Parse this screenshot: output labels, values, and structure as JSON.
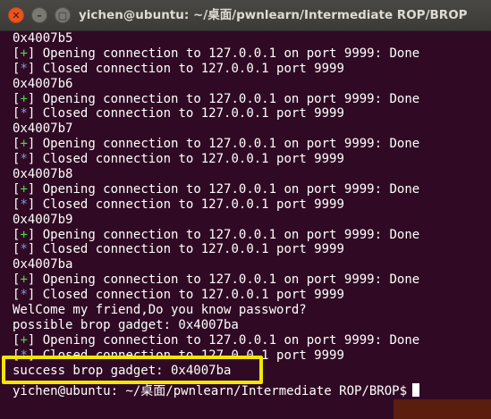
{
  "window": {
    "title": "yichen@ubuntu: ~/桌面/pwnlearn/Intermediate ROP/BROP",
    "close_glyph": "✕",
    "min_glyph": "–",
    "max_glyph": "▢"
  },
  "terminal": {
    "lines": [
      {
        "kind": "plain",
        "text": "0x4007b5"
      },
      {
        "kind": "plus",
        "mark": "+",
        "text": " Opening connection to 127.0.0.1 on port 9999: Done"
      },
      {
        "kind": "star",
        "mark": "*",
        "text": " Closed connection to 127.0.0.1 port 9999"
      },
      {
        "kind": "plain",
        "text": "0x4007b6"
      },
      {
        "kind": "plus",
        "mark": "+",
        "text": " Opening connection to 127.0.0.1 on port 9999: Done"
      },
      {
        "kind": "star",
        "mark": "*",
        "text": " Closed connection to 127.0.0.1 port 9999"
      },
      {
        "kind": "plain",
        "text": "0x4007b7"
      },
      {
        "kind": "plus",
        "mark": "+",
        "text": " Opening connection to 127.0.0.1 on port 9999: Done"
      },
      {
        "kind": "star",
        "mark": "*",
        "text": " Closed connection to 127.0.0.1 port 9999"
      },
      {
        "kind": "plain",
        "text": "0x4007b8"
      },
      {
        "kind": "plus",
        "mark": "+",
        "text": " Opening connection to 127.0.0.1 on port 9999: Done"
      },
      {
        "kind": "star",
        "mark": "*",
        "text": " Closed connection to 127.0.0.1 port 9999"
      },
      {
        "kind": "plain",
        "text": "0x4007b9"
      },
      {
        "kind": "plus",
        "mark": "+",
        "text": " Opening connection to 127.0.0.1 on port 9999: Done"
      },
      {
        "kind": "star",
        "mark": "*",
        "text": " Closed connection to 127.0.0.1 port 9999"
      },
      {
        "kind": "plain",
        "text": "0x4007ba"
      },
      {
        "kind": "plus",
        "mark": "+",
        "text": " Opening connection to 127.0.0.1 on port 9999: Done"
      },
      {
        "kind": "star",
        "mark": "*",
        "text": " Closed connection to 127.0.0.1 port 9999"
      },
      {
        "kind": "plain",
        "text": "WelCome my friend,Do you know password?"
      },
      {
        "kind": "plain",
        "text": "possible brop gadget: 0x4007ba"
      },
      {
        "kind": "plus",
        "mark": "+",
        "text": " Opening connection to 127.0.0.1 on port 9999: Done"
      },
      {
        "kind": "star",
        "mark": "*",
        "text": " Closed connection to 127.0.0.1 port 9999"
      },
      {
        "kind": "plain",
        "text": "success brop gadget: 0x4007ba"
      }
    ],
    "prompt": "yichen@ubuntu: ~/桌面/pwnlearn/Intermediate ROP/BROP$"
  }
}
